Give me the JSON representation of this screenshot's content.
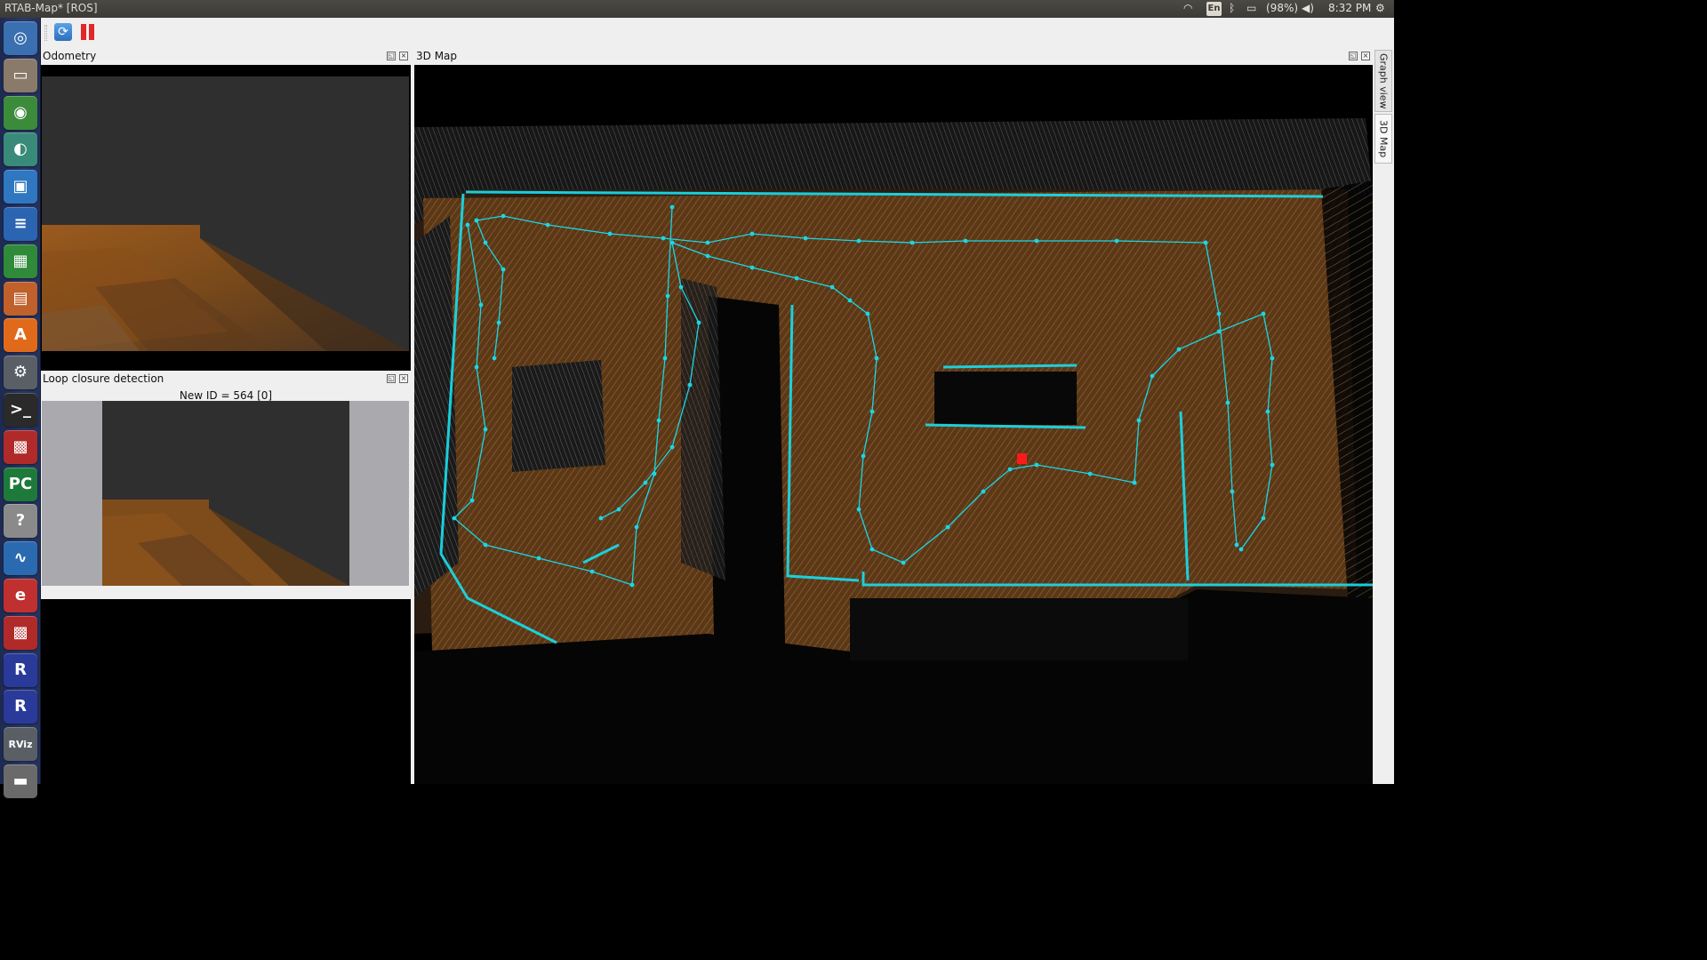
{
  "window": {
    "title": "RTAB-Map* [ROS]"
  },
  "system_tray": {
    "keyboard_layout": "En",
    "battery": "(98%)",
    "clock": "8:32 PM"
  },
  "launcher": {
    "items": [
      {
        "name": "dash-home",
        "glyph": "◎",
        "bg": "#3a6fb0"
      },
      {
        "name": "files",
        "glyph": "▭",
        "bg": "#8a7a6a"
      },
      {
        "name": "chrome",
        "glyph": "◉",
        "bg": "#3b8b3b"
      },
      {
        "name": "network-app",
        "glyph": "◐",
        "bg": "#3a8a7a"
      },
      {
        "name": "virtualbox",
        "glyph": "▣",
        "bg": "#2f77c0"
      },
      {
        "name": "libreoffice-writer",
        "glyph": "≡",
        "bg": "#2b64b0"
      },
      {
        "name": "libreoffice-calc",
        "glyph": "▦",
        "bg": "#2f8a3a"
      },
      {
        "name": "libreoffice-impress",
        "glyph": "▤",
        "bg": "#c0602a"
      },
      {
        "name": "software-center",
        "glyph": "A",
        "bg": "#e06a1a"
      },
      {
        "name": "system-settings",
        "glyph": "⚙",
        "bg": "#5a5f66"
      },
      {
        "name": "terminal",
        "glyph": ">_",
        "bg": "#2a2a2a"
      },
      {
        "name": "rtabmap",
        "glyph": "▩",
        "bg": "#b02a2a"
      },
      {
        "name": "pycharm",
        "glyph": "PC",
        "bg": "#1e7a3a"
      },
      {
        "name": "help",
        "glyph": "?",
        "bg": "#8a8a8a"
      },
      {
        "name": "system-monitor",
        "glyph": "∿",
        "bg": "#2a6ab0"
      },
      {
        "name": "editor",
        "glyph": "e",
        "bg": "#c03030"
      },
      {
        "name": "rtabmap-2",
        "glyph": "▩",
        "bg": "#b02a2a"
      },
      {
        "name": "rqt-r-1",
        "glyph": "R",
        "bg": "#2a3a9a"
      },
      {
        "name": "rqt-r-2",
        "glyph": "R",
        "bg": "#2a3a9a"
      },
      {
        "name": "rviz",
        "glyph": "RViz",
        "bg": "#5a5f66"
      },
      {
        "name": "trash",
        "glyph": "▬",
        "bg": "#6a6a6a"
      }
    ]
  },
  "docks": {
    "odometry": {
      "title": "Odometry"
    },
    "loop_closure": {
      "title": "Loop closure detection",
      "caption": "New ID = 564 [0]"
    },
    "map3d": {
      "title": "3D Map"
    }
  },
  "side_tabs": {
    "graph_view": "Graph view",
    "map_3d": "3D Map"
  },
  "colors": {
    "trajectory": "#19d7e6",
    "wall_cloud": "#7a4f2a",
    "floor": "#6e4a22",
    "current_pose": "#ff1a1a"
  }
}
